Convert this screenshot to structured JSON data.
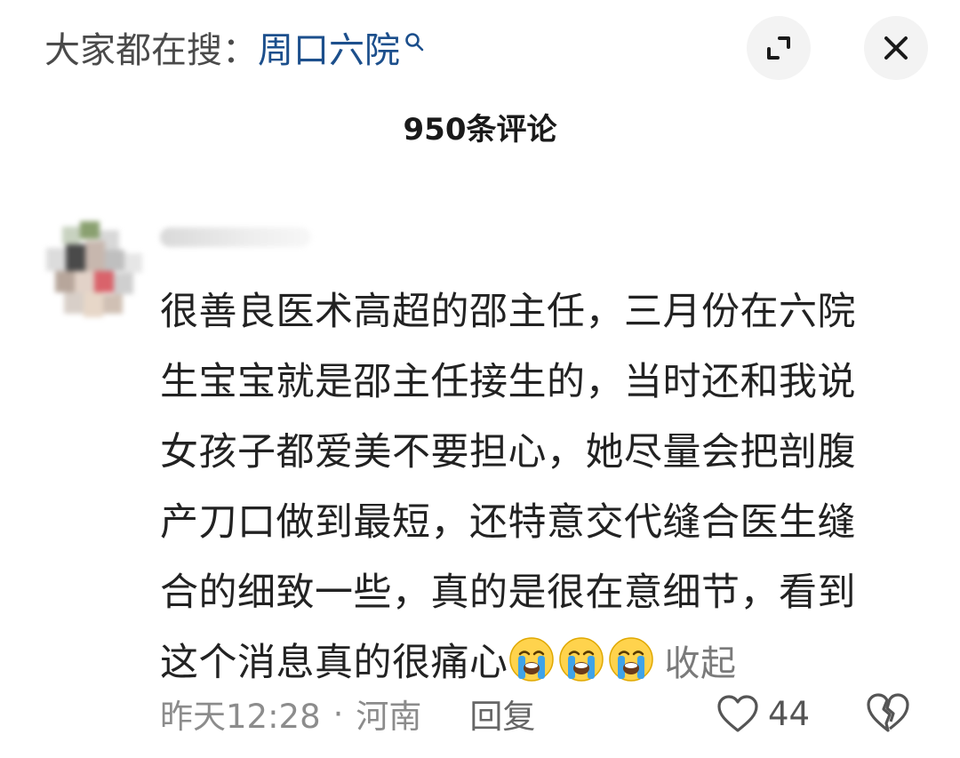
{
  "header": {
    "search_prefix": "大家都在搜：",
    "search_term": "周口六院",
    "search_icon": "search-icon",
    "expand_icon": "expand-icon",
    "close_icon": "close-icon"
  },
  "comments_panel": {
    "count_label": "950条评论"
  },
  "comment": {
    "lines": [
      "很善良医术高超的邵主任，三月份在六院",
      "生宝宝就是邵主任接生的，当时还和我说",
      "女孩子都爱美不要担心，她尽量会把剖腹",
      "产刀口做到最短，还特意交代缝合医生缝",
      "合的细致一些，真的是很在意细节，看到",
      "这个消息真的很痛心"
    ],
    "emojis": [
      "crying-emoji",
      "crying-emoji",
      "crying-emoji"
    ],
    "collapse_label": "收起",
    "time": "昨天12:28",
    "separator": "·",
    "location": "河南",
    "reply_label": "回复",
    "like_count": "44"
  },
  "colors": {
    "search_term": "#1c4f8c",
    "text_primary": "#222222",
    "text_secondary": "#8c8c8c",
    "button_bg": "#f3f3f3"
  }
}
